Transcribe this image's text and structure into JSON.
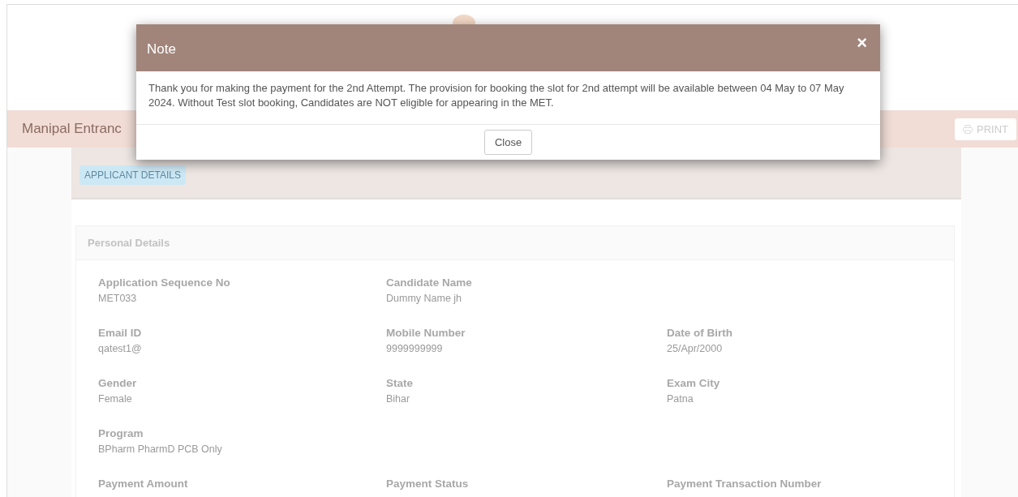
{
  "header": {
    "banner_title": "Manipal Entranc",
    "print_button": "PRINT"
  },
  "section_tab": "APPLICANT DETAILS",
  "panel": {
    "title": "Personal Details",
    "rows": [
      [
        {
          "label": "Application Sequence No",
          "value": "MET033"
        },
        {
          "label": "Candidate Name",
          "value": "Dummy Name jh"
        }
      ],
      [
        {
          "label": "Email ID",
          "value": "qatest1@"
        },
        {
          "label": "Mobile Number",
          "value": "9999999999"
        },
        {
          "label": "Date of Birth",
          "value": "25/Apr/2000"
        }
      ],
      [
        {
          "label": "Gender",
          "value": "Female"
        },
        {
          "label": "State",
          "value": "Bihar"
        },
        {
          "label": "Exam City",
          "value": "Patna"
        }
      ],
      [
        {
          "label": "Program",
          "value": "BPharm PharmD PCB Only"
        }
      ],
      [
        {
          "label": "Payment Amount"
        },
        {
          "label": "Payment Status"
        },
        {
          "label": "Payment Transaction Number"
        }
      ]
    ]
  },
  "modal": {
    "title": "Note",
    "close_icon": "×",
    "message": "Thank you for making the payment for the 2nd Attempt. The provision for booking the slot for 2nd attempt will be available between 04 May to 07 May 2024. Without Test slot booking, Candidates are NOT eligible for appearing in the MET.",
    "button": "Close"
  }
}
